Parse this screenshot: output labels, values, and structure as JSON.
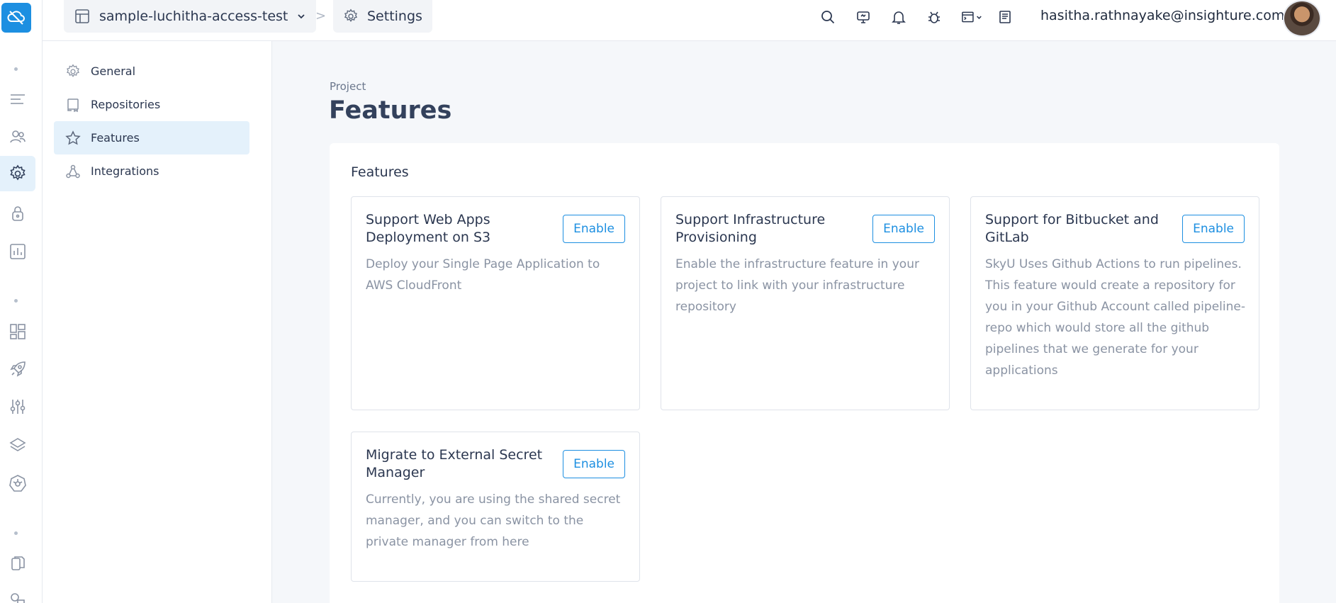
{
  "topbar": {
    "project_name": "sample-luchitha-access-test",
    "separator": ">",
    "section": "Settings",
    "user_email": "hasitha.rathnayake@insighture.com"
  },
  "sidebar": {
    "items": [
      {
        "label": "General",
        "icon": "gear-icon"
      },
      {
        "label": "Repositories",
        "icon": "repository-icon"
      },
      {
        "label": "Features",
        "icon": "star-icon",
        "active": true
      },
      {
        "label": "Integrations",
        "icon": "integrations-icon"
      }
    ]
  },
  "main": {
    "eyebrow": "Project",
    "title": "Features",
    "panel_title": "Features",
    "cards": [
      {
        "title": "Support Web Apps Deployment on S3",
        "button": "Enable",
        "description": "Deploy your Single Page Application to AWS CloudFront"
      },
      {
        "title": "Support Infrastructure Provisioning",
        "button": "Enable",
        "description": "Enable the infrastructure feature in your project to link with your infrastructure repository"
      },
      {
        "title": "Support for Bitbucket and GitLab",
        "button": "Enable",
        "description": "SkyU Uses Github Actions to run pipelines. This feature would create a repository for you in your Github Account called pipeline-repo which would store all the github pipelines that we generate for your applications"
      },
      {
        "title": "Migrate to External Secret Manager",
        "button": "Enable",
        "description": "Currently, you are using the shared secret manager, and you can switch to the private manager from here"
      }
    ]
  },
  "colors": {
    "accent": "#1d8fe1",
    "active_bg": "#e4f1fb",
    "page_bg": "#f5f7fa"
  }
}
